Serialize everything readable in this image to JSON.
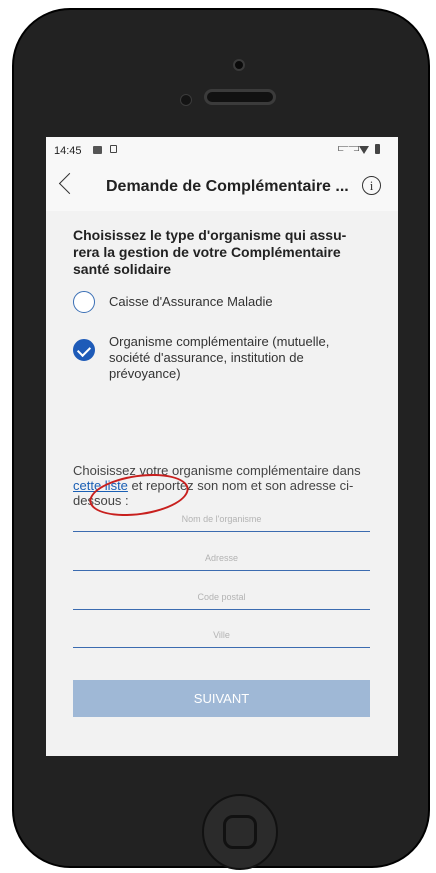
{
  "status_bar": {
    "time": "14:45"
  },
  "header": {
    "title": "Demande de Complémentaire ...",
    "info_symbol": "i"
  },
  "main": {
    "question": "Choisissez le type d'organisme qui assu-rera la gestion de votre Complémentaire santé solidaire",
    "options": [
      {
        "label": "Caisse d'Assurance Maladie",
        "checked": false
      },
      {
        "label": "Organisme complémentaire (mutuelle, société d'assurance, institution de prévoyance)",
        "checked": true
      }
    ],
    "instruction_before": "Choisissez votre organisme complémentaire dans ",
    "instruction_link": "cette liste",
    "instruction_after": " et reportez son nom et son adresse ci-dessous :",
    "fields": {
      "org_name_placeholder": "Nom de l'organisme",
      "address_placeholder": "Adresse",
      "postal_code_placeholder": "Code postal",
      "city_placeholder": "Ville"
    },
    "submit_label": "SUIVANT"
  },
  "colors": {
    "accent": "#1e5bb8",
    "submit_disabled": "#9fb8d6",
    "annotation": "#c8201e"
  }
}
